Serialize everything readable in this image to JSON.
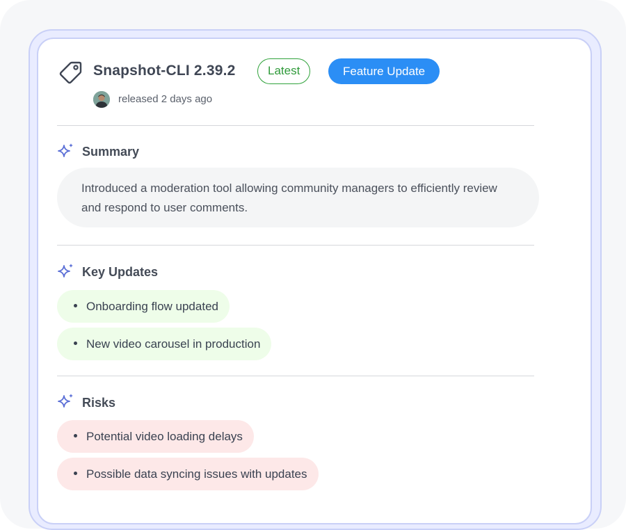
{
  "release": {
    "title": "Snapshot-CLI 2.39.2",
    "badges": [
      "Latest",
      "Feature Update"
    ],
    "meta": "released 2 days ago"
  },
  "summary": {
    "heading": "Summary",
    "text": "Introduced a moderation tool allowing community managers to efficiently review and respond to user comments."
  },
  "key_updates": {
    "heading": "Key Updates",
    "items": [
      "Onboarding flow updated",
      "New video carousel in production"
    ]
  },
  "risks": {
    "heading": "Risks",
    "items": [
      "Potential video loading delays",
      "Possible data syncing issues with updates"
    ]
  },
  "colors": {
    "accent_blue": "#2b8ef5",
    "latest_green": "#2fa23a",
    "update_chip_bg": "#eefde9",
    "risk_chip_bg": "#fde8e8",
    "sparkle": "#5b6fd6"
  },
  "icons": {
    "release": "tag-icon",
    "section": "sparkle-icon",
    "author": "avatar"
  }
}
